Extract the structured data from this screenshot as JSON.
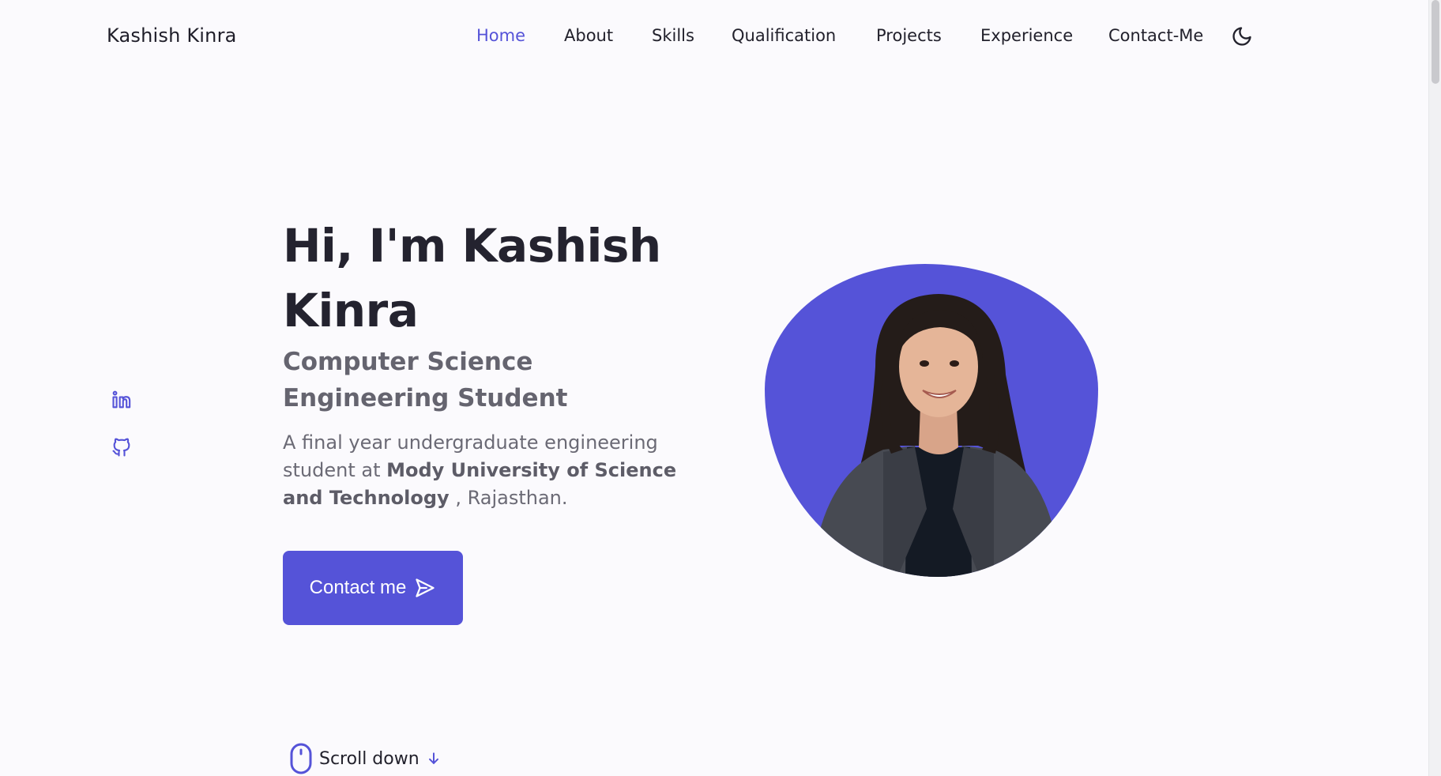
{
  "header": {
    "logo": "Kashish Kinra",
    "nav": [
      {
        "label": "Home",
        "active": true
      },
      {
        "label": "About",
        "active": false
      },
      {
        "label": "Skills",
        "active": false
      },
      {
        "label": "Qualification",
        "active": false
      },
      {
        "label": "Projects",
        "active": false
      },
      {
        "label": "Experience",
        "active": false
      },
      {
        "label": "Contact-Me",
        "active": false
      }
    ],
    "theme_icon": "moon-icon"
  },
  "social": [
    {
      "icon": "linkedin-icon"
    },
    {
      "icon": "github-icon"
    }
  ],
  "hero": {
    "title": "Hi, I'm Kashish Kinra",
    "subtitle": "Computer Science Engineering Student",
    "desc_prefix": "A final year undergraduate engineering student at ",
    "desc_bold": "Mody University of Science and Technology",
    "desc_suffix": " , Rajasthan.",
    "button_label": "Contact me",
    "button_icon": "send-icon",
    "scroll_label": "Scroll down",
    "scroll_icon": "mouse-icon",
    "arrow_icon": "arrow-down-icon"
  },
  "colors": {
    "accent": "#5553d8",
    "background": "#fbfafd",
    "text": "#24232f",
    "muted": "#65646f"
  }
}
